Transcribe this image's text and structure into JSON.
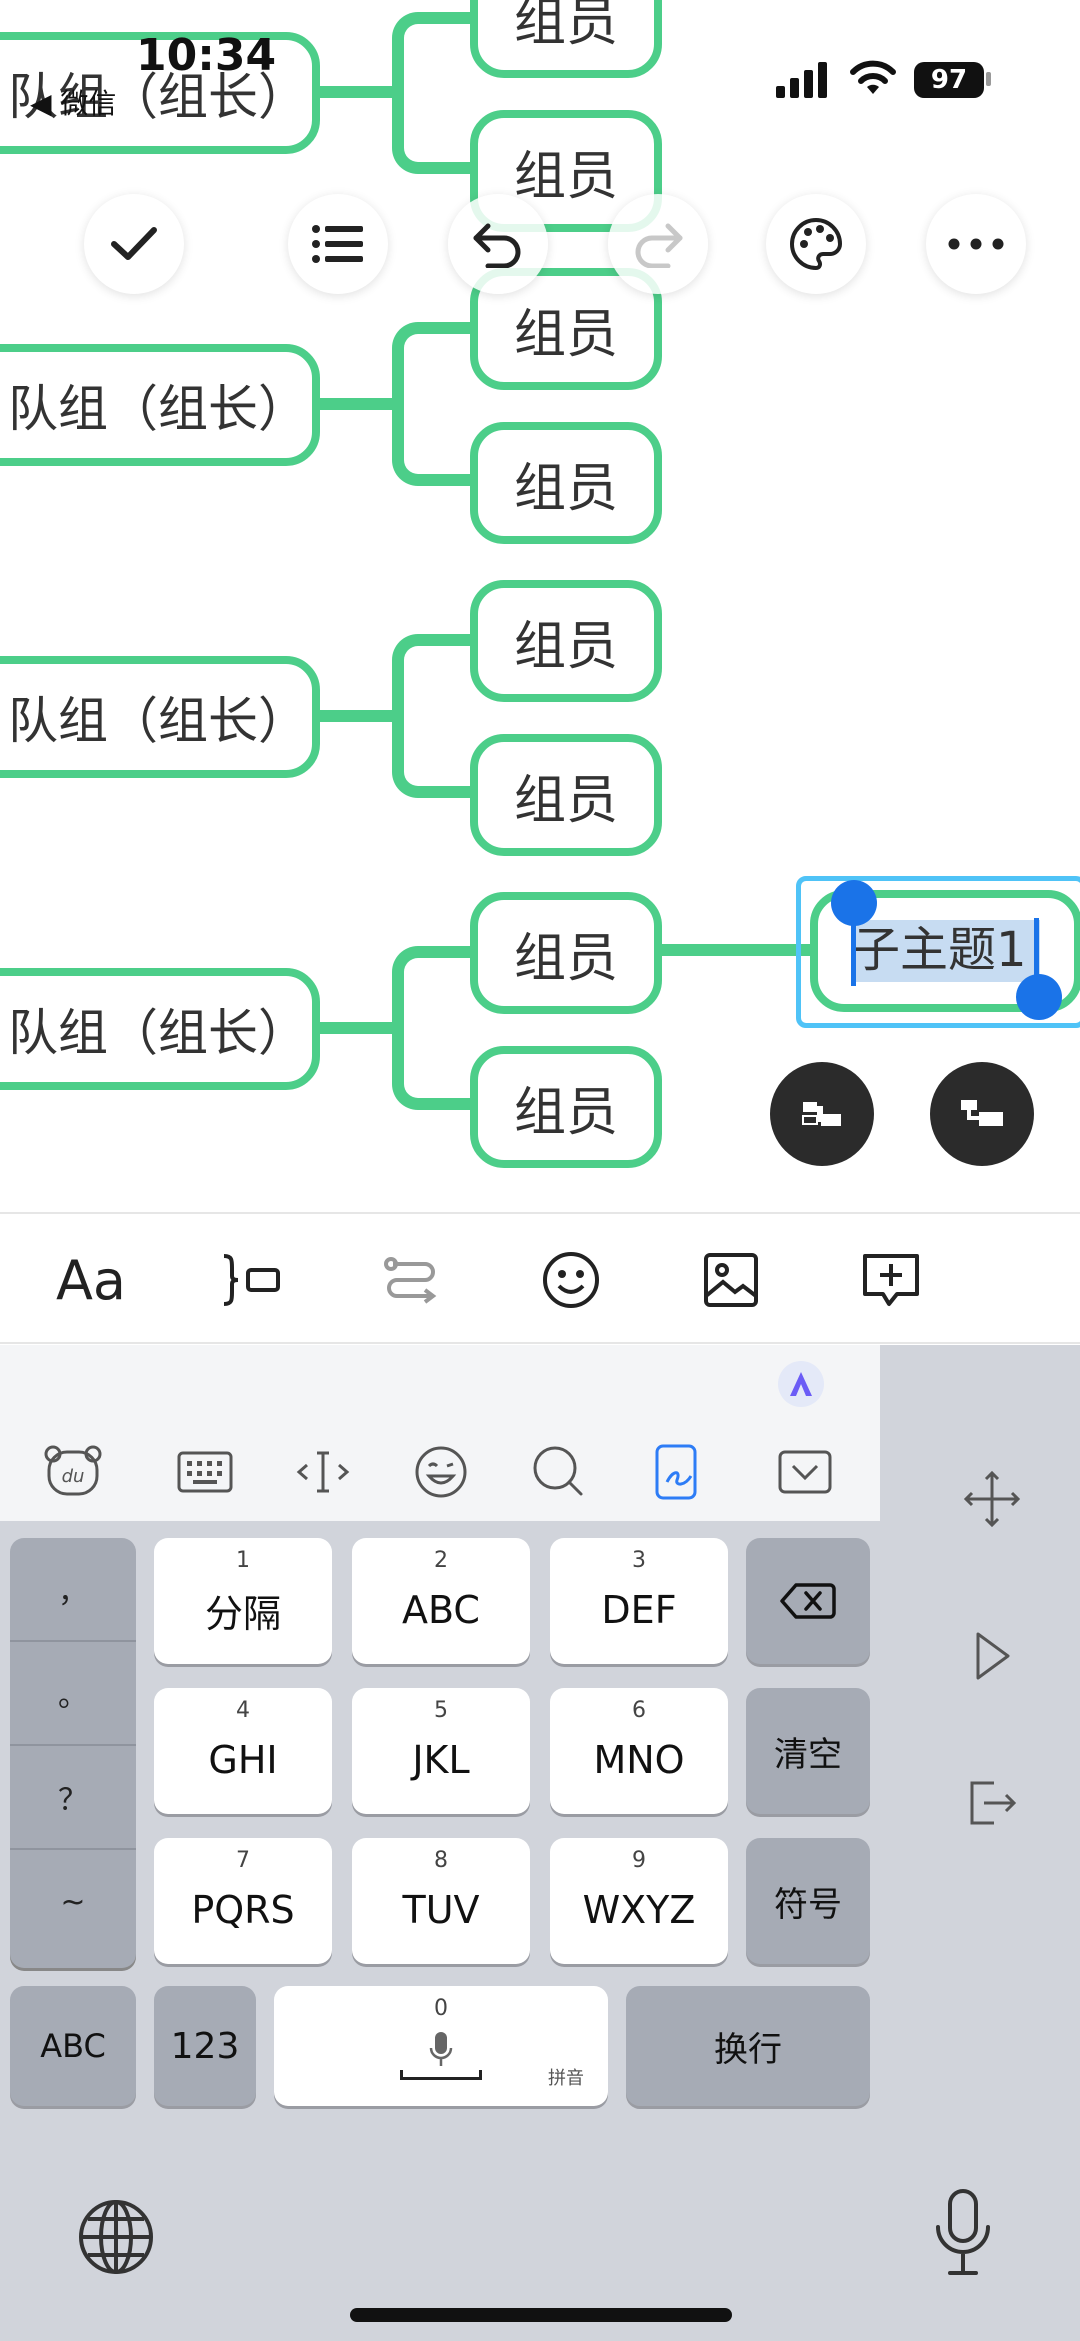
{
  "status_bar": {
    "time": "10:34",
    "back_app": "◀ 微信",
    "battery": "97"
  },
  "mindmap": {
    "leaders": [
      "队组（组长）",
      "队组（组长）",
      "队组（组长）",
      "队组（组长）"
    ],
    "member_label": "组员",
    "selected_node_text": "子主题1"
  },
  "toolbar": {
    "icons": [
      "check-icon",
      "outline-list-icon",
      "undo-icon",
      "redo-icon",
      "palette-icon",
      "more-icon"
    ]
  },
  "format_bar": {
    "icons": [
      "text-style-icon",
      "insert-topic-icon",
      "relationship-icon",
      "emoji-icon",
      "image-icon",
      "add-comment-icon"
    ],
    "text_style_label": "Aa"
  },
  "keyboard": {
    "punct": [
      "，",
      "。",
      "？",
      "~"
    ],
    "keys": [
      {
        "num": "1",
        "label": "分隔"
      },
      {
        "num": "2",
        "label": "ABC"
      },
      {
        "num": "3",
        "label": "DEF"
      },
      {
        "num": "4",
        "label": "GHI"
      },
      {
        "num": "5",
        "label": "JKL"
      },
      {
        "num": "6",
        "label": "MNO"
      },
      {
        "num": "7",
        "label": "PQRS"
      },
      {
        "num": "8",
        "label": "TUV"
      },
      {
        "num": "9",
        "label": "WXYZ"
      }
    ],
    "clear": "清空",
    "symbol": "符号",
    "abc": "ABC",
    "num123": "123",
    "space_num": "0",
    "space_sub": "拼音",
    "enter": "换行"
  }
}
